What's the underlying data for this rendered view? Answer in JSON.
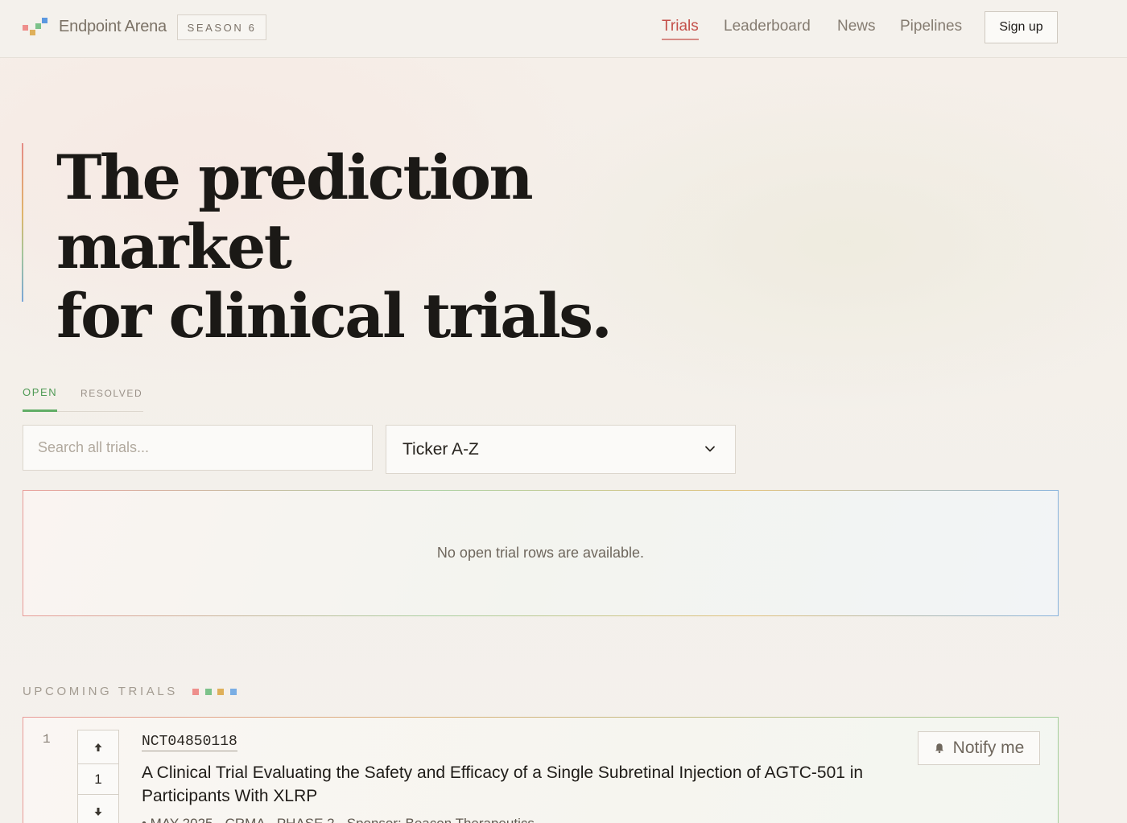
{
  "header": {
    "brand": "Endpoint Arena",
    "season": "SEASON 6",
    "nav": [
      {
        "label": "Trials",
        "active": true
      },
      {
        "label": "Leaderboard",
        "active": false
      },
      {
        "label": "News",
        "active": false
      },
      {
        "label": "Pipelines",
        "active": false
      }
    ],
    "signup_label": "Sign up"
  },
  "hero": {
    "title_line1": "The prediction market",
    "title_line2": "for clinical trials."
  },
  "tabs": [
    {
      "label": "OPEN",
      "active": true
    },
    {
      "label": "RESOLVED",
      "active": false
    }
  ],
  "filters": {
    "search_placeholder": "Search all trials...",
    "search_value": "",
    "sort_selected": "Ticker A-Z"
  },
  "empty_state": {
    "message": "No open trial rows are available."
  },
  "upcoming": {
    "label": "UPCOMING TRIALS",
    "legend_colors": [
      "#ee8f8c",
      "#7cc28a",
      "#dfb05a",
      "#7aaee4"
    ],
    "trials": [
      {
        "rank": "1",
        "votes": "1",
        "id": "NCT04850118",
        "title": "A Clinical Trial Evaluating the Safety and Efficacy of a Single Subretinal Injection of AGTC-501 in Participants With XLRP",
        "meta": "• MAY 2025 · CRMA · PHASE 2 · Sponsor: Beacon Therapeutics",
        "notify_label": "Notify me"
      }
    ]
  },
  "colors": {
    "brand_red": "#c4504a",
    "open_green": "#4f9a55",
    "logo": [
      "#ee8f8c",
      "#dfb05a",
      "#7cc28a",
      "#5b98e0"
    ]
  }
}
